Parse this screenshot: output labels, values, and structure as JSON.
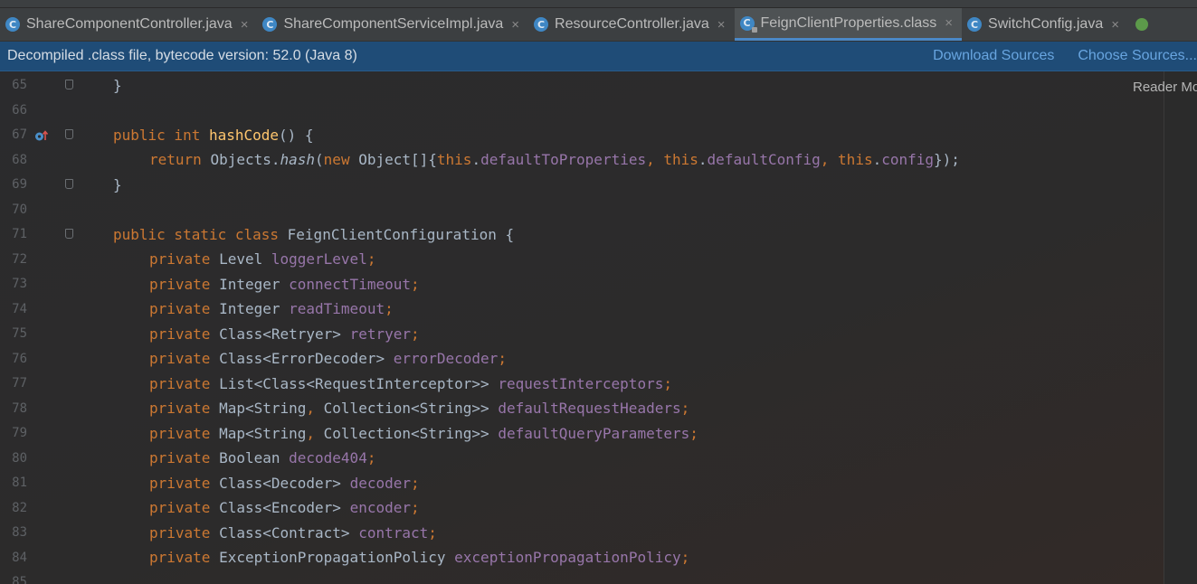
{
  "tabs": [
    {
      "label": "ShareComponentController.java",
      "close": "×",
      "active": false
    },
    {
      "label": "ShareComponentServiceImpl.java",
      "close": "×",
      "active": false
    },
    {
      "label": "ResourceController.java",
      "close": "×",
      "active": false
    },
    {
      "label": "FeignClientProperties.class",
      "close": "×",
      "active": true
    },
    {
      "label": "SwitchConfig.java",
      "close": "×",
      "active": false
    }
  ],
  "tab_icon_letter": "C",
  "banner": {
    "message": "Decompiled .class file, bytecode version: 52.0 (Java 8)",
    "download_sources": "Download Sources",
    "choose_sources": "Choose Sources..."
  },
  "reader_mode": "Reader Mode",
  "lines": [
    {
      "num": "65",
      "tokens": [
        [
          "}",
          "p"
        ]
      ]
    },
    {
      "num": "66",
      "tokens": []
    },
    {
      "num": "67",
      "tokens": [
        [
          "public int ",
          "kw"
        ],
        [
          "hashCode",
          "fn"
        ],
        [
          "() {",
          "p"
        ]
      ]
    },
    {
      "num": "68",
      "tokens": [
        [
          "return ",
          "kw"
        ],
        [
          "Objects.",
          "p"
        ],
        [
          "hash",
          "it"
        ],
        [
          "(",
          "p"
        ],
        [
          "new ",
          "kw"
        ],
        [
          "Object[]{",
          "p"
        ],
        [
          "this",
          "kw"
        ],
        [
          ".",
          "p"
        ],
        [
          "defaultToProperties",
          "fld"
        ],
        [
          ", ",
          "kw"
        ],
        [
          "this",
          "kw"
        ],
        [
          ".",
          "p"
        ],
        [
          "defaultConfig",
          "fld"
        ],
        [
          ", ",
          "kw"
        ],
        [
          "this",
          "kw"
        ],
        [
          ".",
          "p"
        ],
        [
          "config",
          "fld"
        ],
        [
          "});",
          "p"
        ]
      ]
    },
    {
      "num": "69",
      "tokens": [
        [
          "}",
          "p"
        ]
      ]
    },
    {
      "num": "70",
      "tokens": []
    },
    {
      "num": "71",
      "tokens": [
        [
          "public static class ",
          "kw"
        ],
        [
          "FeignClientConfiguration {",
          "p"
        ]
      ]
    },
    {
      "num": "72",
      "tokens": [
        [
          "private ",
          "kw"
        ],
        [
          "Level ",
          "p"
        ],
        [
          "loggerLevel",
          "fld"
        ],
        [
          ";",
          "kw"
        ]
      ]
    },
    {
      "num": "73",
      "tokens": [
        [
          "private ",
          "kw"
        ],
        [
          "Integer ",
          "p"
        ],
        [
          "connectTimeout",
          "fld"
        ],
        [
          ";",
          "kw"
        ]
      ]
    },
    {
      "num": "74",
      "tokens": [
        [
          "private ",
          "kw"
        ],
        [
          "Integer ",
          "p"
        ],
        [
          "readTimeout",
          "fld"
        ],
        [
          ";",
          "kw"
        ]
      ]
    },
    {
      "num": "75",
      "tokens": [
        [
          "private ",
          "kw"
        ],
        [
          "Class<Retryer> ",
          "p"
        ],
        [
          "retryer",
          "fld"
        ],
        [
          ";",
          "kw"
        ]
      ]
    },
    {
      "num": "76",
      "tokens": [
        [
          "private ",
          "kw"
        ],
        [
          "Class<ErrorDecoder> ",
          "p"
        ],
        [
          "errorDecoder",
          "fld"
        ],
        [
          ";",
          "kw"
        ]
      ]
    },
    {
      "num": "77",
      "tokens": [
        [
          "private ",
          "kw"
        ],
        [
          "List<Class<RequestInterceptor>> ",
          "p"
        ],
        [
          "requestInterceptors",
          "fld"
        ],
        [
          ";",
          "kw"
        ]
      ]
    },
    {
      "num": "78",
      "tokens": [
        [
          "private ",
          "kw"
        ],
        [
          "Map<String",
          "p"
        ],
        [
          ", ",
          "kw"
        ],
        [
          "Collection<String>> ",
          "p"
        ],
        [
          "defaultRequestHeaders",
          "fld"
        ],
        [
          ";",
          "kw"
        ]
      ]
    },
    {
      "num": "79",
      "tokens": [
        [
          "private ",
          "kw"
        ],
        [
          "Map<String",
          "p"
        ],
        [
          ", ",
          "kw"
        ],
        [
          "Collection<String>> ",
          "p"
        ],
        [
          "defaultQueryParameters",
          "fld"
        ],
        [
          ";",
          "kw"
        ]
      ]
    },
    {
      "num": "80",
      "tokens": [
        [
          "private ",
          "kw"
        ],
        [
          "Boolean ",
          "p"
        ],
        [
          "decode404",
          "fld"
        ],
        [
          ";",
          "kw"
        ]
      ]
    },
    {
      "num": "81",
      "tokens": [
        [
          "private ",
          "kw"
        ],
        [
          "Class<Decoder> ",
          "p"
        ],
        [
          "decoder",
          "fld"
        ],
        [
          ";",
          "kw"
        ]
      ]
    },
    {
      "num": "82",
      "tokens": [
        [
          "private ",
          "kw"
        ],
        [
          "Class<Encoder> ",
          "p"
        ],
        [
          "encoder",
          "fld"
        ],
        [
          ";",
          "kw"
        ]
      ]
    },
    {
      "num": "83",
      "tokens": [
        [
          "private ",
          "kw"
        ],
        [
          "Class<Contract> ",
          "p"
        ],
        [
          "contract",
          "fld"
        ],
        [
          ";",
          "kw"
        ]
      ]
    },
    {
      "num": "84",
      "tokens": [
        [
          "private ",
          "kw"
        ],
        [
          "ExceptionPropagationPolicy ",
          "p"
        ],
        [
          "exceptionPropagationPolicy",
          "fld"
        ],
        [
          ";",
          "kw"
        ]
      ]
    },
    {
      "num": "85",
      "tokens": []
    }
  ],
  "colors": {
    "keyword": "#cc7832",
    "method": "#ffc66d",
    "field": "#9876aa",
    "plain": "#a9b7c6",
    "banner_bg": "#1f4c77",
    "link": "#68a5e0",
    "active_tab_underline": "#4a88c7"
  }
}
